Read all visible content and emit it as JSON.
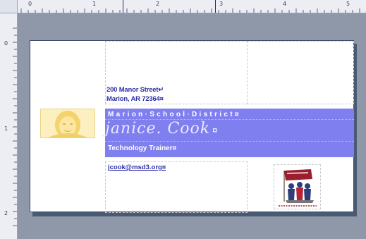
{
  "rulers": {
    "top_numbers": [
      "0",
      "1",
      "2",
      "3",
      "4",
      "5"
    ],
    "left_numbers": [
      "0",
      "1",
      "2"
    ]
  },
  "card": {
    "address_line1": "200 Manor Street↵",
    "address_line2": "Marion, AR 72364¤",
    "district": "Marion·School·District¤",
    "name": "janice. Cook",
    "name_mark": "¤",
    "job_title": "Technology Trainer¤",
    "email": "jcook@msd3.org¤"
  },
  "colors": {
    "band": "#7f7ff0",
    "text_blue": "#2e2ea8",
    "photo_tint": "#fbe8a6"
  }
}
